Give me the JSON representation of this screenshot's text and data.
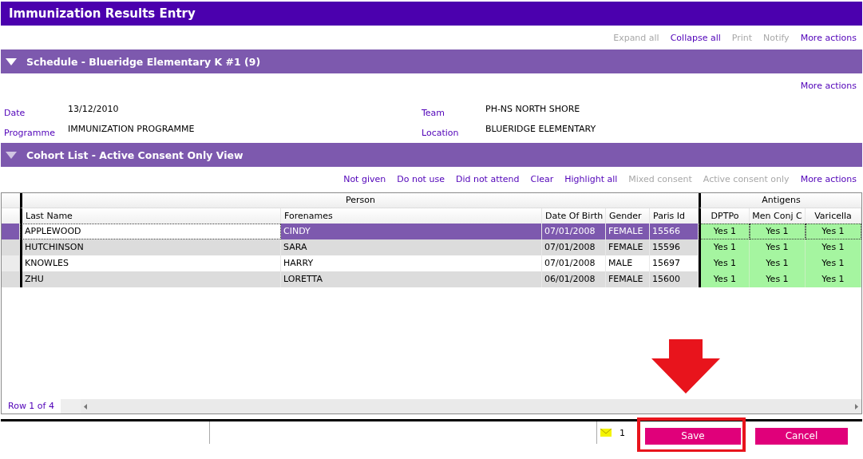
{
  "window": {
    "title": "Immunization Results Entry"
  },
  "toolbar": [
    {
      "label": "Expand all",
      "disabled": true
    },
    {
      "label": "Collapse all",
      "disabled": false
    },
    {
      "label": "Print",
      "disabled": true
    },
    {
      "label": "Notify",
      "disabled": true
    },
    {
      "label": "More actions",
      "disabled": false
    }
  ],
  "schedule": {
    "title": "Schedule - Blueridge Elementary K #1 (9)",
    "expanded": true,
    "actions": [
      {
        "label": "More actions",
        "disabled": false
      }
    ],
    "fields": [
      {
        "label": "Date",
        "value": "13/12/2010"
      },
      {
        "label": "Team",
        "value": "PH-NS NORTH SHORE"
      },
      {
        "label": "Programme",
        "value": "IMMUNIZATION PROGRAMME"
      },
      {
        "label": "Location",
        "value": "BLUERIDGE ELEMENTARY"
      }
    ]
  },
  "cohort": {
    "title": "Cohort List - Active Consent Only View",
    "expanded": true,
    "actions": [
      {
        "label": "Not given",
        "disabled": false
      },
      {
        "label": "Do not use",
        "disabled": false
      },
      {
        "label": "Did not attend",
        "disabled": false
      },
      {
        "label": "Clear",
        "disabled": false
      },
      {
        "label": "Highlight all",
        "disabled": false
      },
      {
        "label": "Mixed consent",
        "disabled": true
      },
      {
        "label": "Active consent only",
        "disabled": true
      },
      {
        "label": "More actions",
        "disabled": false
      }
    ],
    "table": {
      "groups": [
        {
          "label": "Person",
          "columns": [
            "Last Name",
            "Forenames",
            "Date Of Birth",
            "Gender",
            "Paris Id"
          ]
        },
        {
          "label": "Antigens",
          "columns": [
            "DPTPo",
            "Men Conj C",
            "Varicella"
          ]
        }
      ],
      "rows": [
        {
          "selected": true,
          "cells": [
            "APPLEWOOD",
            "CINDY",
            "07/01/2008",
            "FEMALE",
            "15566",
            "Yes 1",
            "Yes 1",
            "Yes 1"
          ]
        },
        {
          "selected": false,
          "cells": [
            "HUTCHINSON",
            "SARA",
            "07/01/2008",
            "FEMALE",
            "15596",
            "Yes 1",
            "Yes 1",
            "Yes 1"
          ]
        },
        {
          "selected": false,
          "cells": [
            "KNOWLES",
            "HARRY",
            "07/01/2008",
            "MALE",
            "15697",
            "Yes 1",
            "Yes 1",
            "Yes 1"
          ]
        },
        {
          "selected": false,
          "cells": [
            "ZHU",
            "LORETTA",
            "06/01/2008",
            "FEMALE",
            "15600",
            "Yes 1",
            "Yes 1",
            "Yes 1"
          ]
        }
      ],
      "status": "Row 1 of 4"
    }
  },
  "footer": {
    "message_count": "1",
    "buttons": [
      {
        "label": "Save",
        "highlighted": true
      },
      {
        "label": "Cancel",
        "highlighted": false
      }
    ]
  }
}
